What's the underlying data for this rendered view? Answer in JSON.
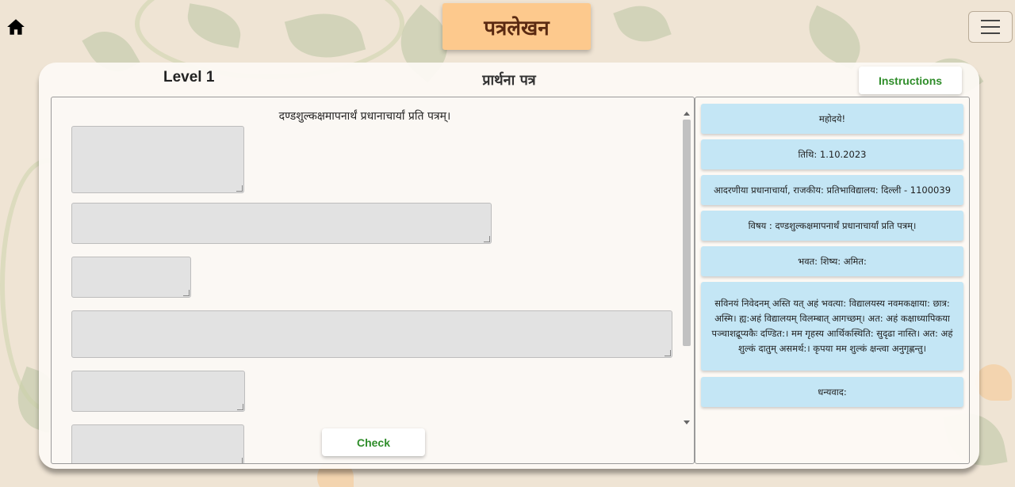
{
  "header": {
    "title": "पत्रलेखन"
  },
  "card": {
    "level_label": "Level 1",
    "subtitle": "प्रार्थना पत्र",
    "instructions_label": "Instructions"
  },
  "letter": {
    "heading": "दण्डशुल्कक्षमापनार्थं प्रधानाचार्यां प्रति पत्रम्।",
    "slots": [
      {
        "value": ""
      },
      {
        "value": ""
      },
      {
        "value": ""
      },
      {
        "value": ""
      },
      {
        "value": ""
      },
      {
        "value": ""
      }
    ],
    "check_label": "Check"
  },
  "options": [
    "महोदये!",
    "तिथि: 1.10.2023",
    "आदरणीया प्रधानाचार्या, राजकीय: प्रतिभाविद्यालय: दिल्ली - 1100039",
    "विषय : दण्डशुल्कक्षमापनार्थं प्रधानाचार्यां प्रति पत्रम्।",
    "भवत: शिष्य: अमित:",
    "सविनयं निवेदनम् अस्ति यत् अहं भवत्या: विद्यालयस्य नवमकक्षाया: छात्र: अस्मि। ह्य:अहं विद्यालयम् विलम्बात् आगच्छम्। अत: अहं कक्षाध्यापिकया पञ्चाशद्रूप्यकैः दण्डित:। मम गृहस्य आर्थिकस्थिति: सुदृढा नास्ति। अत: अहं शुल्कं दातुम् असमर्थ:। कृपया मम शुल्कं क्षन्त्वा अनुगृह्णन्तु।",
    "धन्यवाद:"
  ],
  "colors": {
    "title_bg": "#fdc98d",
    "option_bg": "#c4e6f5",
    "button_text": "#2f8d2a",
    "slot_bg": "#e2e2e2"
  },
  "icons": {
    "home": "home-icon",
    "menu": "hamburger-menu-icon"
  }
}
